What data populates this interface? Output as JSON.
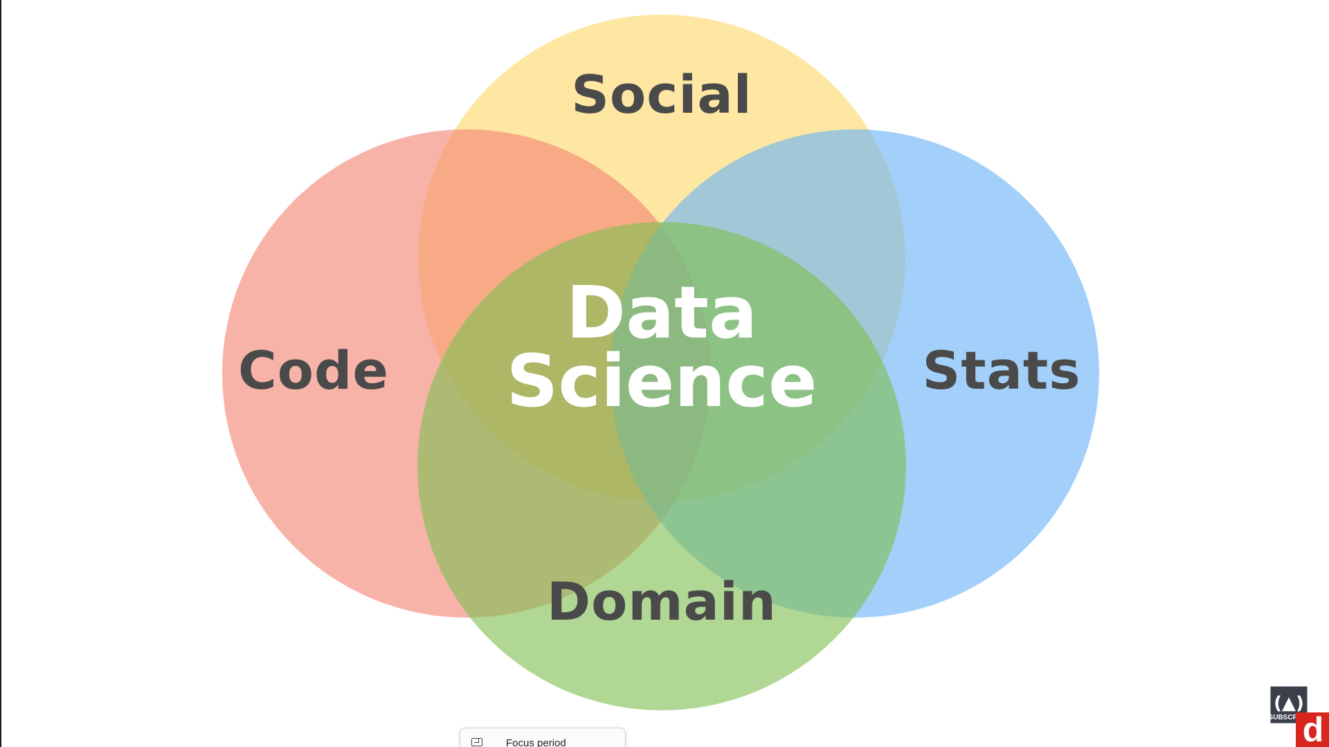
{
  "diagram": {
    "center_label_line1": "Data",
    "center_label_line2": "Science",
    "circles": {
      "social": {
        "label": "Social",
        "color": "#fcd86b"
      },
      "code": {
        "label": "Code",
        "color": "#f48472"
      },
      "stats": {
        "label": "Stats",
        "color": "#6ab3f7"
      },
      "domain": {
        "label": "Domain",
        "color": "#7fbf52"
      }
    },
    "circle_opacity": 0.62
  },
  "overlay": {
    "subscribe_label": "SUBSCRIBE",
    "subscribe_icon": "flame-icon",
    "channel_logo_letter": "d",
    "channel_logo_color": "#d7261e"
  },
  "focus_popup": {
    "icon": "focus-window-icon",
    "label": "Focus period"
  }
}
